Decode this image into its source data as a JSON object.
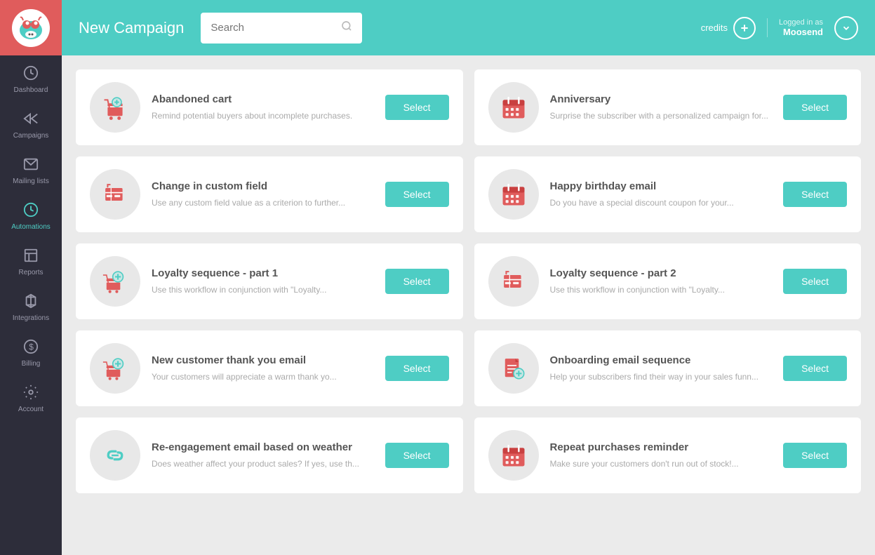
{
  "sidebar": {
    "logo": "🐮",
    "items": [
      {
        "id": "dashboard",
        "label": "Dashboard",
        "icon": "⏱",
        "active": false
      },
      {
        "id": "campaigns",
        "label": "Campaigns",
        "icon": "📢",
        "active": false
      },
      {
        "id": "mailing-lists",
        "label": "Mailing lists",
        "icon": "✉",
        "active": false
      },
      {
        "id": "automations",
        "label": "Automations",
        "icon": "🕐",
        "active": true
      },
      {
        "id": "reports",
        "label": "Reports",
        "icon": "📊",
        "active": false
      },
      {
        "id": "integrations",
        "label": "Integrations",
        "icon": "◇",
        "active": false
      },
      {
        "id": "billing",
        "label": "Billing",
        "icon": "$",
        "active": false
      },
      {
        "id": "account",
        "label": "Account",
        "icon": "⚙",
        "active": false
      }
    ]
  },
  "header": {
    "title": "New Campaign",
    "search_placeholder": "Search",
    "credits_label": "credits",
    "logged_in_as": "Logged in as",
    "username": "Moosend",
    "add_icon": "+",
    "dropdown_icon": "▾"
  },
  "cards": [
    {
      "id": "abandoned-cart",
      "title": "Abandoned cart",
      "description": "Remind potential buyers about incomplete purchases.",
      "icon_type": "cart",
      "select_label": "Select"
    },
    {
      "id": "anniversary",
      "title": "Anniversary",
      "description": "Surprise the subscriber with a personalized campaign for...",
      "icon_type": "calendar",
      "select_label": "Select"
    },
    {
      "id": "change-custom-field",
      "title": "Change in custom field",
      "description": "Use any custom field value as a criterion to further...",
      "icon_type": "custom-field",
      "select_label": "Select"
    },
    {
      "id": "happy-birthday",
      "title": "Happy birthday email",
      "description": "Do you have a special discount coupon for your...",
      "icon_type": "calendar",
      "select_label": "Select"
    },
    {
      "id": "loyalty-part1",
      "title": "Loyalty sequence - part 1",
      "description": "Use this workflow in conjunction with \"Loyalty...",
      "icon_type": "cart-plus",
      "select_label": "Select"
    },
    {
      "id": "loyalty-part2",
      "title": "Loyalty sequence - part 2",
      "description": "Use this workflow in conjunction with \"Loyalty...",
      "icon_type": "custom-field",
      "select_label": "Select"
    },
    {
      "id": "new-customer-thank",
      "title": "New customer thank you email",
      "description": "Your customers will appreciate a warm thank yo...",
      "icon_type": "cart-plus",
      "select_label": "Select"
    },
    {
      "id": "onboarding-email",
      "title": "Onboarding email sequence",
      "description": "Help your subscribers find their way in your sales funn...",
      "icon_type": "doc-plus",
      "select_label": "Select"
    },
    {
      "id": "reengagement-weather",
      "title": "Re-engagement email based on weather",
      "description": "Does weather affect your product sales? If yes, use th...",
      "icon_type": "link",
      "select_label": "Select"
    },
    {
      "id": "repeat-purchases",
      "title": "Repeat purchases reminder",
      "description": "Make sure your customers don't run out of stock!...",
      "icon_type": "calendar",
      "select_label": "Select"
    }
  ]
}
